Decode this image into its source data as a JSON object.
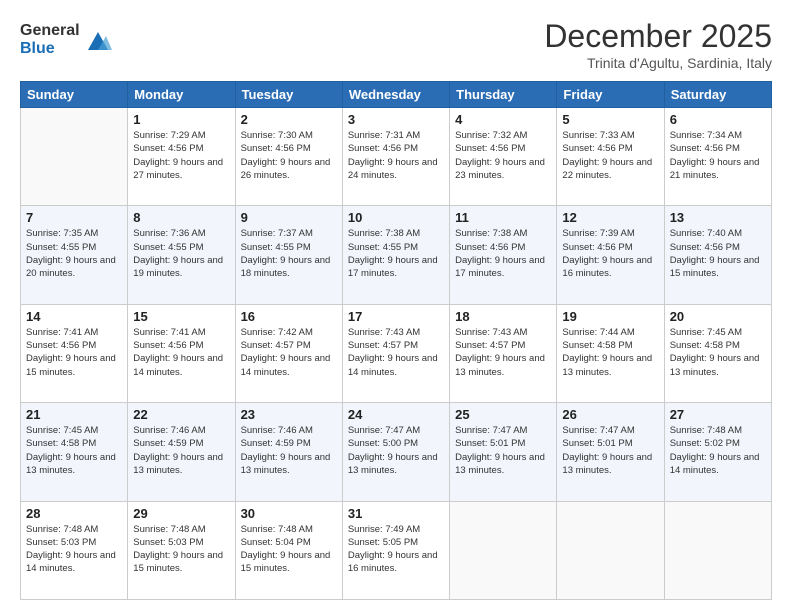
{
  "logo": {
    "general": "General",
    "blue": "Blue"
  },
  "title": "December 2025",
  "location": "Trinita d'Agultu, Sardinia, Italy",
  "weekdays": [
    "Sunday",
    "Monday",
    "Tuesday",
    "Wednesday",
    "Thursday",
    "Friday",
    "Saturday"
  ],
  "weeks": [
    [
      {
        "day": "",
        "sunrise": "",
        "sunset": "",
        "daylight": ""
      },
      {
        "day": "1",
        "sunrise": "Sunrise: 7:29 AM",
        "sunset": "Sunset: 4:56 PM",
        "daylight": "Daylight: 9 hours and 27 minutes."
      },
      {
        "day": "2",
        "sunrise": "Sunrise: 7:30 AM",
        "sunset": "Sunset: 4:56 PM",
        "daylight": "Daylight: 9 hours and 26 minutes."
      },
      {
        "day": "3",
        "sunrise": "Sunrise: 7:31 AM",
        "sunset": "Sunset: 4:56 PM",
        "daylight": "Daylight: 9 hours and 24 minutes."
      },
      {
        "day": "4",
        "sunrise": "Sunrise: 7:32 AM",
        "sunset": "Sunset: 4:56 PM",
        "daylight": "Daylight: 9 hours and 23 minutes."
      },
      {
        "day": "5",
        "sunrise": "Sunrise: 7:33 AM",
        "sunset": "Sunset: 4:56 PM",
        "daylight": "Daylight: 9 hours and 22 minutes."
      },
      {
        "day": "6",
        "sunrise": "Sunrise: 7:34 AM",
        "sunset": "Sunset: 4:56 PM",
        "daylight": "Daylight: 9 hours and 21 minutes."
      }
    ],
    [
      {
        "day": "7",
        "sunrise": "Sunrise: 7:35 AM",
        "sunset": "Sunset: 4:55 PM",
        "daylight": "Daylight: 9 hours and 20 minutes."
      },
      {
        "day": "8",
        "sunrise": "Sunrise: 7:36 AM",
        "sunset": "Sunset: 4:55 PM",
        "daylight": "Daylight: 9 hours and 19 minutes."
      },
      {
        "day": "9",
        "sunrise": "Sunrise: 7:37 AM",
        "sunset": "Sunset: 4:55 PM",
        "daylight": "Daylight: 9 hours and 18 minutes."
      },
      {
        "day": "10",
        "sunrise": "Sunrise: 7:38 AM",
        "sunset": "Sunset: 4:55 PM",
        "daylight": "Daylight: 9 hours and 17 minutes."
      },
      {
        "day": "11",
        "sunrise": "Sunrise: 7:38 AM",
        "sunset": "Sunset: 4:56 PM",
        "daylight": "Daylight: 9 hours and 17 minutes."
      },
      {
        "day": "12",
        "sunrise": "Sunrise: 7:39 AM",
        "sunset": "Sunset: 4:56 PM",
        "daylight": "Daylight: 9 hours and 16 minutes."
      },
      {
        "day": "13",
        "sunrise": "Sunrise: 7:40 AM",
        "sunset": "Sunset: 4:56 PM",
        "daylight": "Daylight: 9 hours and 15 minutes."
      }
    ],
    [
      {
        "day": "14",
        "sunrise": "Sunrise: 7:41 AM",
        "sunset": "Sunset: 4:56 PM",
        "daylight": "Daylight: 9 hours and 15 minutes."
      },
      {
        "day": "15",
        "sunrise": "Sunrise: 7:41 AM",
        "sunset": "Sunset: 4:56 PM",
        "daylight": "Daylight: 9 hours and 14 minutes."
      },
      {
        "day": "16",
        "sunrise": "Sunrise: 7:42 AM",
        "sunset": "Sunset: 4:57 PM",
        "daylight": "Daylight: 9 hours and 14 minutes."
      },
      {
        "day": "17",
        "sunrise": "Sunrise: 7:43 AM",
        "sunset": "Sunset: 4:57 PM",
        "daylight": "Daylight: 9 hours and 14 minutes."
      },
      {
        "day": "18",
        "sunrise": "Sunrise: 7:43 AM",
        "sunset": "Sunset: 4:57 PM",
        "daylight": "Daylight: 9 hours and 13 minutes."
      },
      {
        "day": "19",
        "sunrise": "Sunrise: 7:44 AM",
        "sunset": "Sunset: 4:58 PM",
        "daylight": "Daylight: 9 hours and 13 minutes."
      },
      {
        "day": "20",
        "sunrise": "Sunrise: 7:45 AM",
        "sunset": "Sunset: 4:58 PM",
        "daylight": "Daylight: 9 hours and 13 minutes."
      }
    ],
    [
      {
        "day": "21",
        "sunrise": "Sunrise: 7:45 AM",
        "sunset": "Sunset: 4:58 PM",
        "daylight": "Daylight: 9 hours and 13 minutes."
      },
      {
        "day": "22",
        "sunrise": "Sunrise: 7:46 AM",
        "sunset": "Sunset: 4:59 PM",
        "daylight": "Daylight: 9 hours and 13 minutes."
      },
      {
        "day": "23",
        "sunrise": "Sunrise: 7:46 AM",
        "sunset": "Sunset: 4:59 PM",
        "daylight": "Daylight: 9 hours and 13 minutes."
      },
      {
        "day": "24",
        "sunrise": "Sunrise: 7:47 AM",
        "sunset": "Sunset: 5:00 PM",
        "daylight": "Daylight: 9 hours and 13 minutes."
      },
      {
        "day": "25",
        "sunrise": "Sunrise: 7:47 AM",
        "sunset": "Sunset: 5:01 PM",
        "daylight": "Daylight: 9 hours and 13 minutes."
      },
      {
        "day": "26",
        "sunrise": "Sunrise: 7:47 AM",
        "sunset": "Sunset: 5:01 PM",
        "daylight": "Daylight: 9 hours and 13 minutes."
      },
      {
        "day": "27",
        "sunrise": "Sunrise: 7:48 AM",
        "sunset": "Sunset: 5:02 PM",
        "daylight": "Daylight: 9 hours and 14 minutes."
      }
    ],
    [
      {
        "day": "28",
        "sunrise": "Sunrise: 7:48 AM",
        "sunset": "Sunset: 5:03 PM",
        "daylight": "Daylight: 9 hours and 14 minutes."
      },
      {
        "day": "29",
        "sunrise": "Sunrise: 7:48 AM",
        "sunset": "Sunset: 5:03 PM",
        "daylight": "Daylight: 9 hours and 15 minutes."
      },
      {
        "day": "30",
        "sunrise": "Sunrise: 7:48 AM",
        "sunset": "Sunset: 5:04 PM",
        "daylight": "Daylight: 9 hours and 15 minutes."
      },
      {
        "day": "31",
        "sunrise": "Sunrise: 7:49 AM",
        "sunset": "Sunset: 5:05 PM",
        "daylight": "Daylight: 9 hours and 16 minutes."
      },
      {
        "day": "",
        "sunrise": "",
        "sunset": "",
        "daylight": ""
      },
      {
        "day": "",
        "sunrise": "",
        "sunset": "",
        "daylight": ""
      },
      {
        "day": "",
        "sunrise": "",
        "sunset": "",
        "daylight": ""
      }
    ]
  ]
}
